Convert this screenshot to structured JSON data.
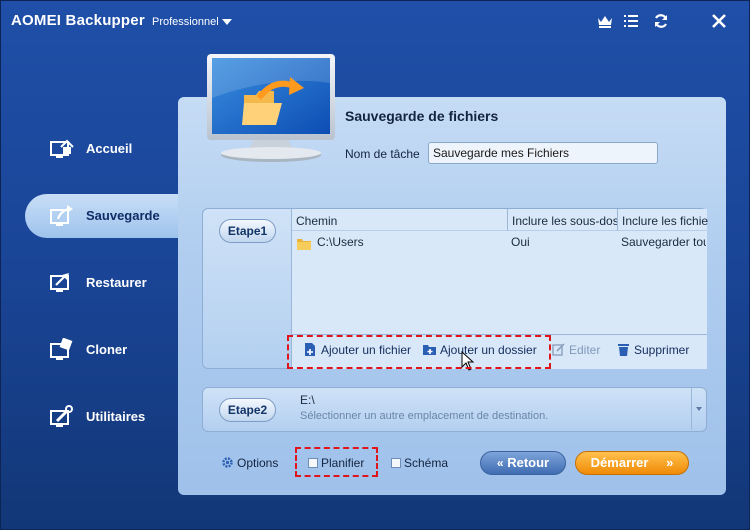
{
  "app": {
    "title": "AOMEI Backupper",
    "edition": "Professionnel"
  },
  "titlebar_icons": [
    "crown-icon",
    "menu-list-icon",
    "refresh-icon",
    "close-icon"
  ],
  "sidebar": {
    "items": [
      {
        "label": "Accueil",
        "icon": "home-icon",
        "active": false
      },
      {
        "label": "Sauvegarde",
        "icon": "backup-icon",
        "active": true
      },
      {
        "label": "Restaurer",
        "icon": "restore-icon",
        "active": false
      },
      {
        "label": "Cloner",
        "icon": "clone-icon",
        "active": false
      },
      {
        "label": "Utilitaires",
        "icon": "tools-icon",
        "active": false
      }
    ]
  },
  "main": {
    "title": "Sauvegarde de fichiers",
    "task_label": "Nom de tâche",
    "task_value": "Sauvegarde mes Fichiers",
    "step1": {
      "label": "Etape1",
      "columns": [
        "Chemin",
        "Inclure les sous-dossiers",
        "Inclure les fichiers"
      ],
      "rows": [
        {
          "path": "C:\\Users",
          "subfolders": "Oui",
          "files": "Sauvegarder tous"
        }
      ],
      "actions": {
        "add_file": "Ajouter un fichier",
        "add_folder": "Ajouter un dossier",
        "edit": "Editer",
        "delete": "Supprimer"
      }
    },
    "step2": {
      "label": "Etape2",
      "dest_value": "E:\\",
      "dest_hint": "Sélectionner un autre emplacement de destination."
    },
    "bottom": {
      "options": "Options",
      "schedule": "Planifier",
      "scheme": "Schéma",
      "back": "Retour",
      "start": "Démarrer"
    }
  },
  "colors": {
    "window_bg": "#1f4fa8",
    "panel_bg": "#c6dcf5",
    "start_button": "#f08a07",
    "highlight": "#e0141b"
  }
}
